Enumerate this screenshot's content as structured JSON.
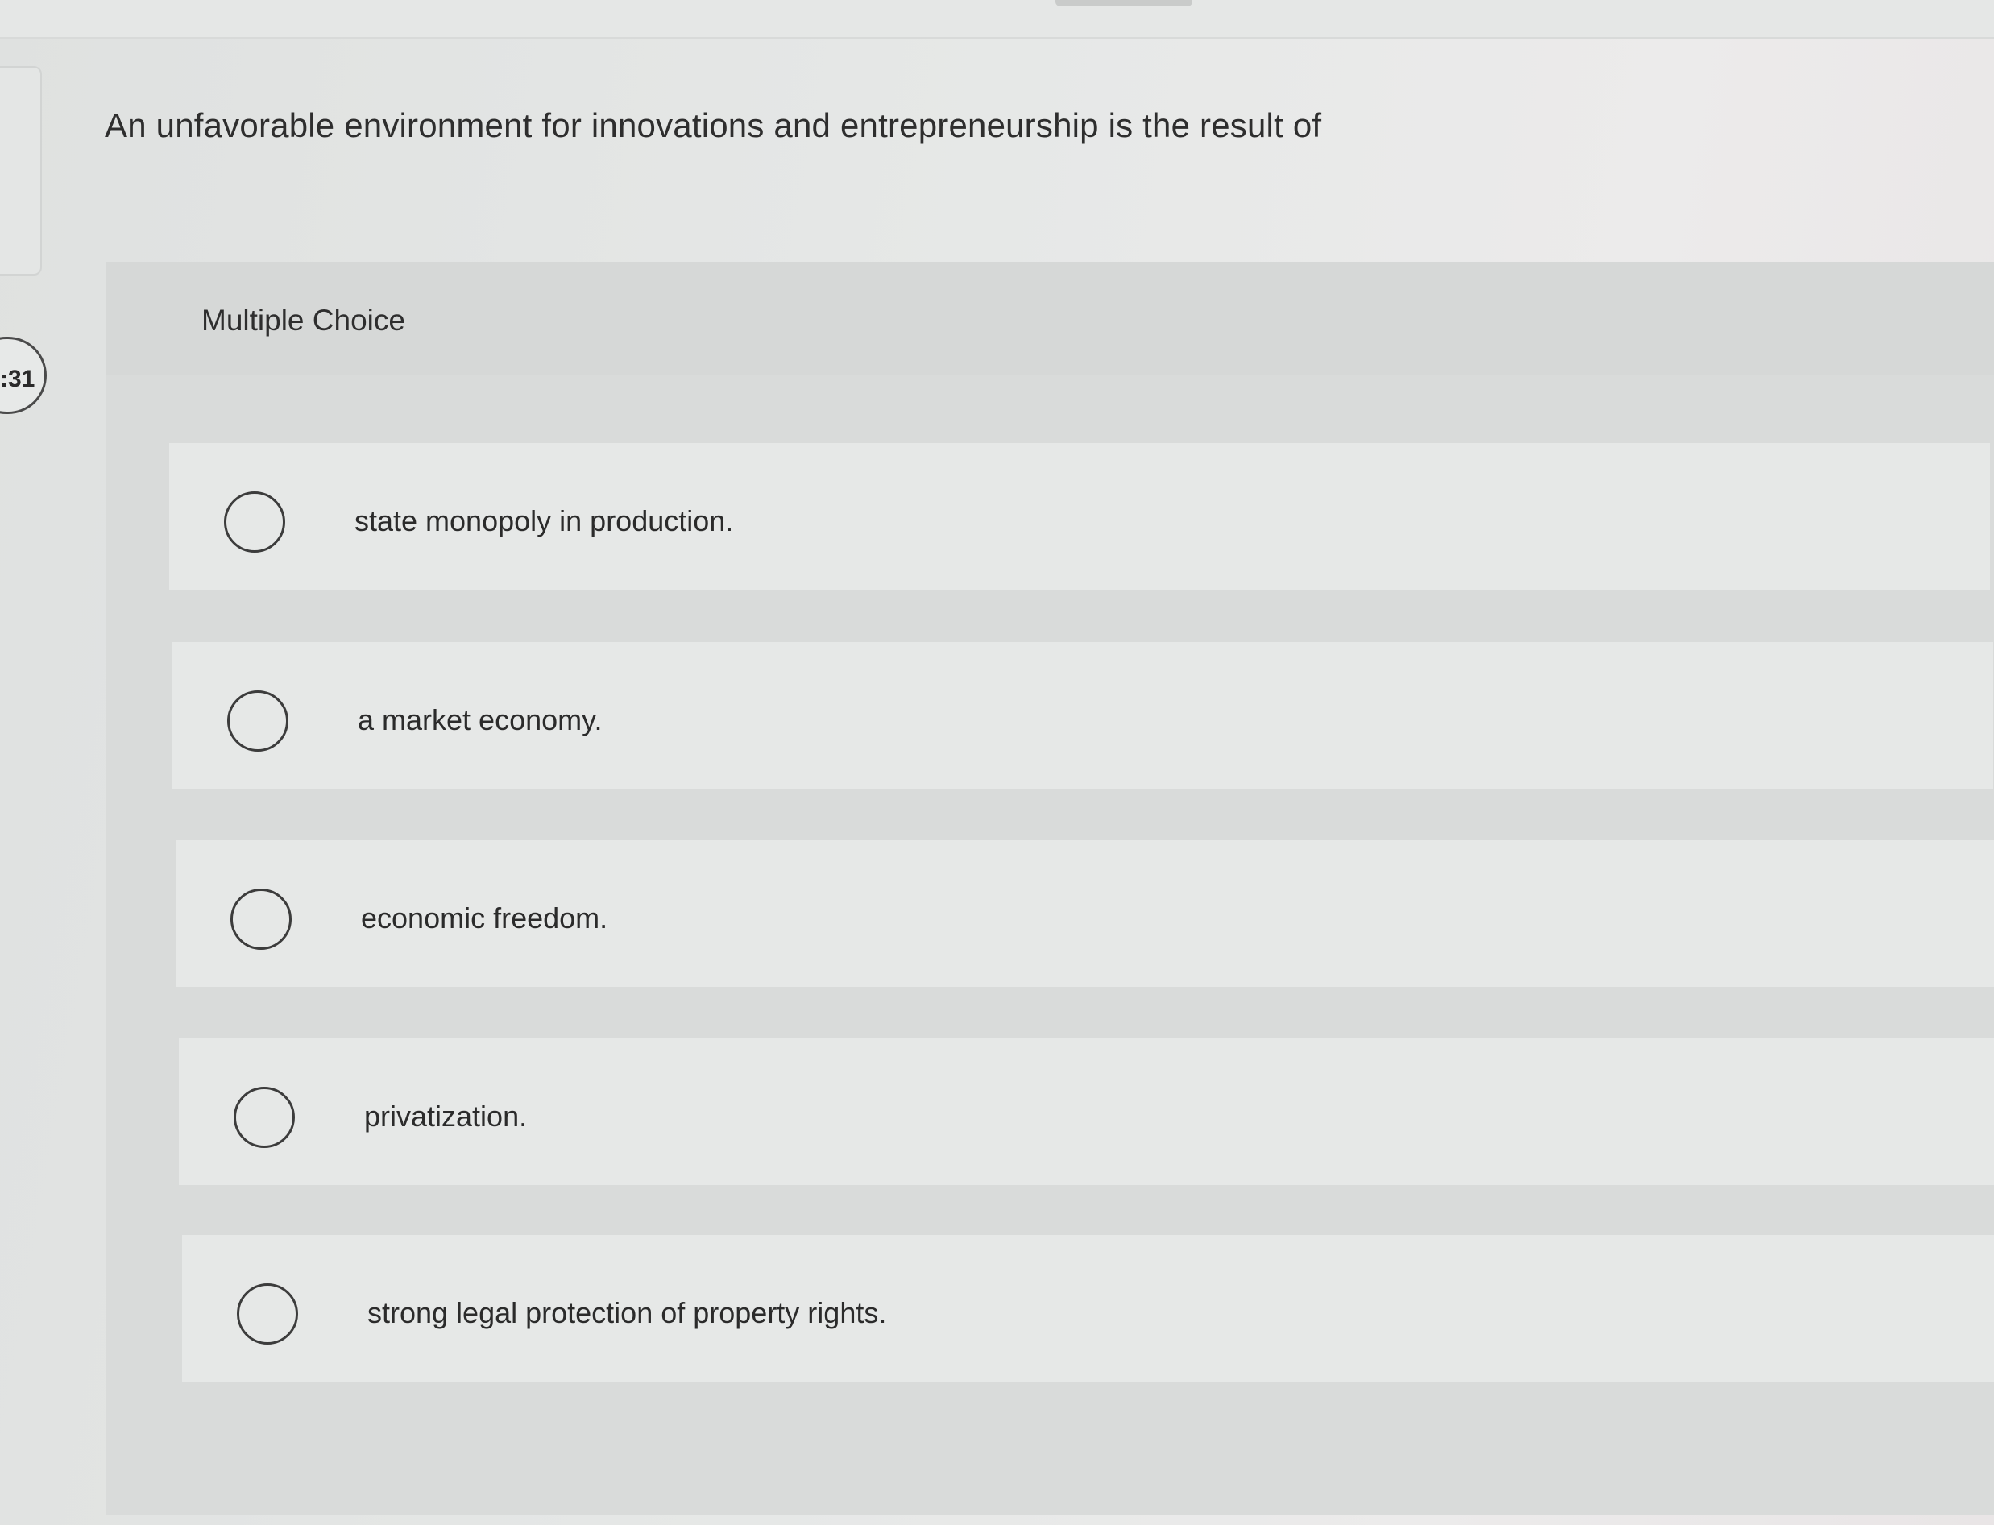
{
  "timer": {
    "text": ":31"
  },
  "question": {
    "text": "An unfavorable environment for innovations and entrepreneurship is the result of"
  },
  "multiple_choice": {
    "label": "Multiple Choice",
    "options": [
      {
        "label": "state monopoly in production.",
        "selected": false
      },
      {
        "label": "a market economy.",
        "selected": false
      },
      {
        "label": "economic freedom.",
        "selected": false
      },
      {
        "label": "privatization.",
        "selected": false
      },
      {
        "label": "strong legal protection of property rights.",
        "selected": false
      }
    ]
  }
}
